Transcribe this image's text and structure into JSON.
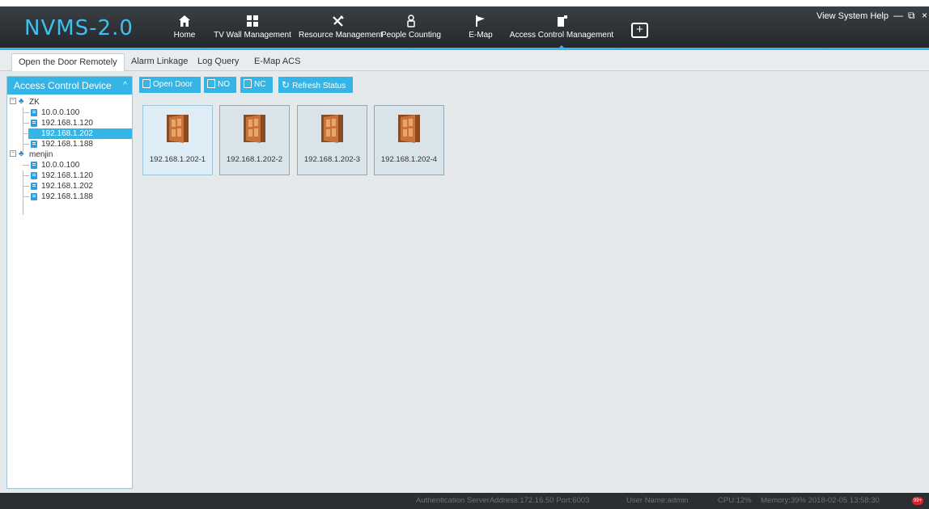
{
  "app": {
    "logo": "NVMS-2.0",
    "system_menu": "View System Help",
    "minimize": "—",
    "restore": "⧉",
    "close": "×"
  },
  "nav": {
    "home": "Home",
    "tvwall": "TV Wall Management",
    "resource": "Resource Management",
    "people": "People Counting",
    "emap": "E-Map",
    "access": "Access Control Management",
    "add": "+"
  },
  "tabs": [
    "Open the Door Remotely",
    "Alarm Linkage",
    "Log Query",
    "E-Map ACS"
  ],
  "sidebar": {
    "title": "Access Control Device",
    "groups": [
      {
        "name": "ZK",
        "devices": [
          "10.0.0.100",
          "192.168.1.120",
          "192.168.1.202",
          "192.168.1.188"
        ]
      },
      {
        "name": "menjin",
        "devices": [
          "10.0.0.100",
          "192.168.1.120",
          "192.168.1.202",
          "192.168.1.188"
        ]
      }
    ]
  },
  "toolbar": {
    "open_door": "Open Door",
    "no": "NO",
    "nc": "NC",
    "refresh": "Refresh Status"
  },
  "doors": [
    "192.168.1.202-1",
    "192.168.1.202-2",
    "192.168.1.202-3",
    "192.168.1.202-4"
  ],
  "status": {
    "auth": "Authentication ServerAddress:172.16.50 Port:6003",
    "user": "User Name:admin",
    "cpu": "CPU:12%",
    "memory": "Memory:39% 2018-02-05 13:58:30",
    "badge": "99+"
  },
  "colors": {
    "accent": "#35b4e6",
    "topbar": "#2b2f33",
    "door": "#c8733a"
  }
}
